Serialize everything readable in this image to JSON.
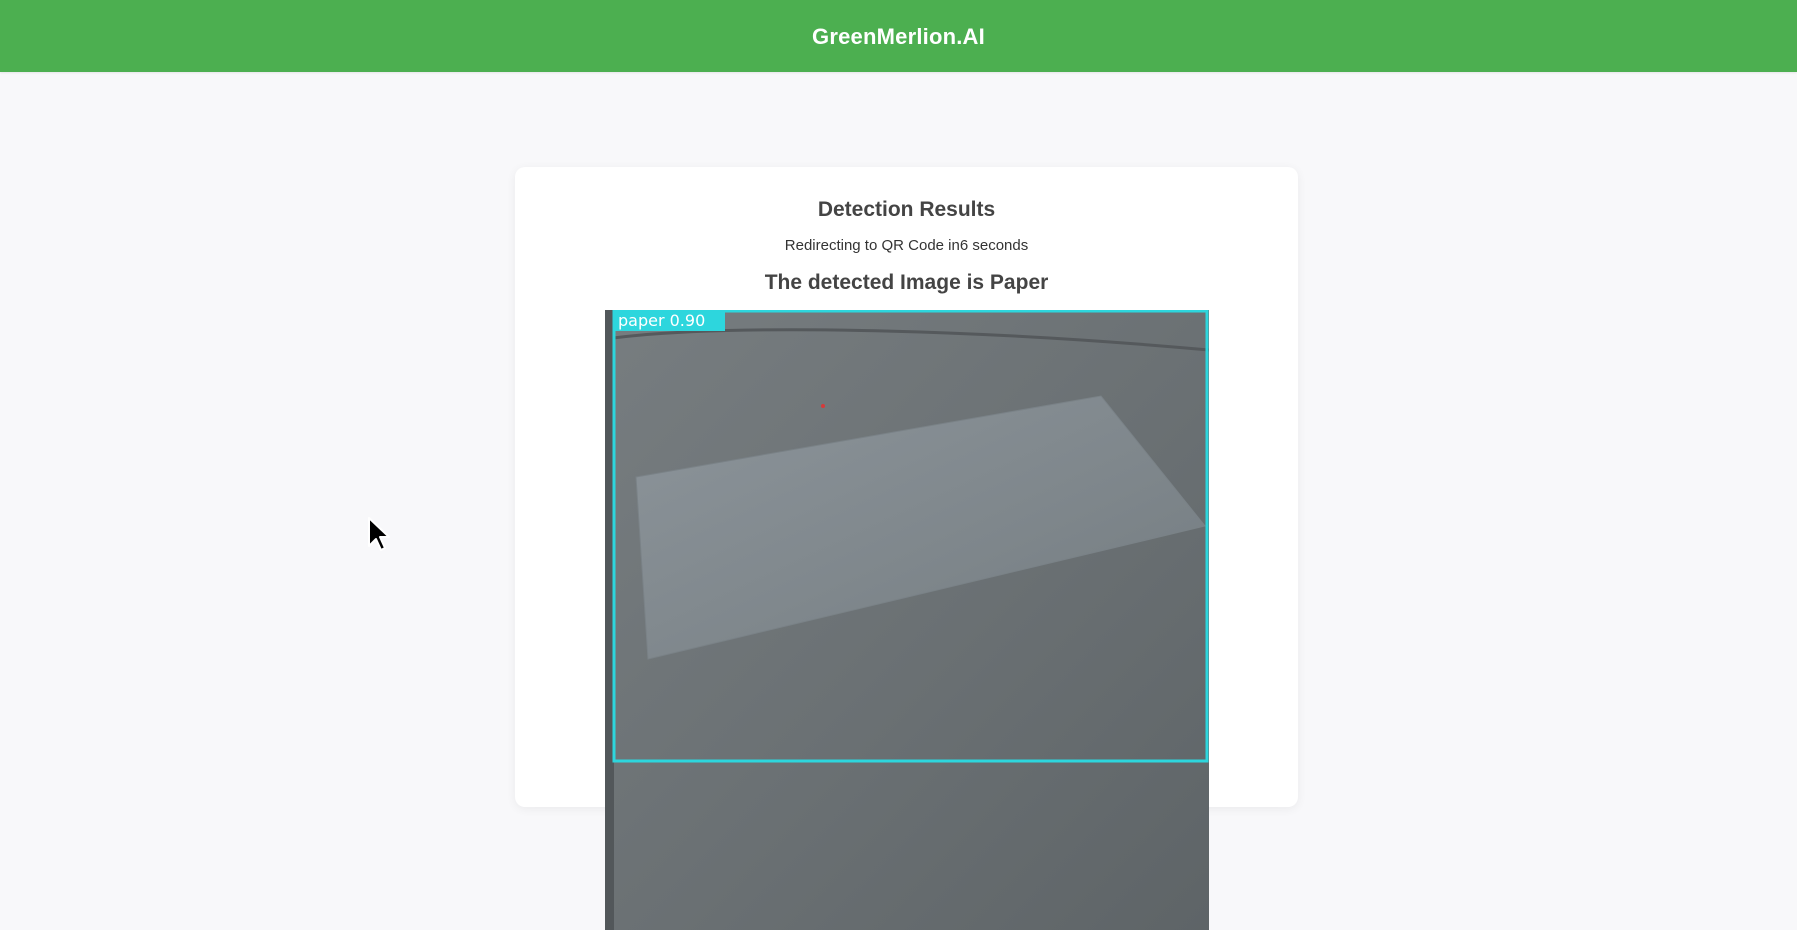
{
  "header": {
    "brand": "GreenMerlion.AI",
    "background_color": "#4caf50"
  },
  "card": {
    "title": "Detection Results",
    "redirect_text": "Redirecting to QR Code in6 seconds",
    "result_heading": "The detected Image is Paper"
  },
  "detection": {
    "label": "paper 0.90",
    "box_color": "#2dd6dd"
  }
}
